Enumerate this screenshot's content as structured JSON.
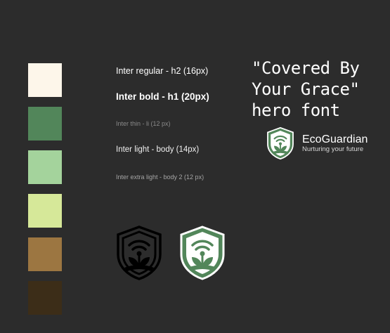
{
  "palette": [
    {
      "name": "cream",
      "color": "#fdf6ea"
    },
    {
      "name": "forest-green",
      "color": "#52865a"
    },
    {
      "name": "light-green",
      "color": "#a4d39c"
    },
    {
      "name": "lime",
      "color": "#d6e899"
    },
    {
      "name": "brown",
      "color": "#9c7641"
    },
    {
      "name": "dark-brown",
      "color": "#3c2d18"
    }
  ],
  "typography": {
    "h2": "Inter regular - h2 (16px)",
    "h1": "Inter bold -  h1 (20px)",
    "li": "Inter thin - li (12 px)",
    "body": "Inter light - body (14px)",
    "body2": "Inter extra light - body 2 (12 px)"
  },
  "hero_font": {
    "line1": "\"Covered By",
    "line2": "Your Grace\"",
    "line3": "hero font"
  },
  "brand": {
    "name": "EcoGuardian",
    "tagline": "Nurturing your future",
    "icon": "shield-sprout-wifi-icon",
    "primary_color": "#52865a"
  }
}
